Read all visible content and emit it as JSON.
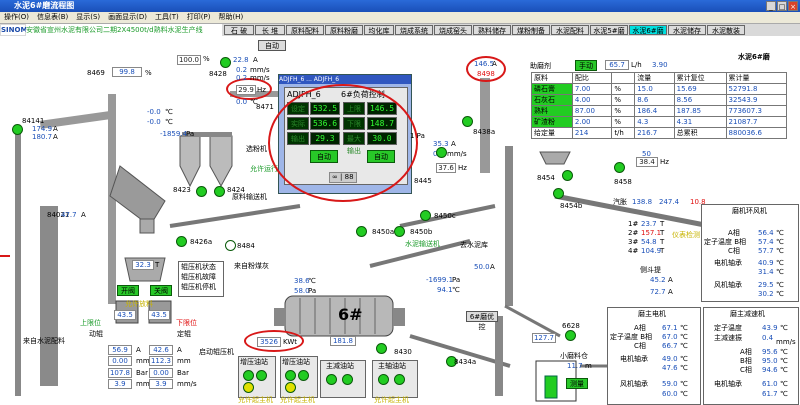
{
  "window": {
    "title": "水泥6#磨流程图",
    "btn_min": "_",
    "btn_max": "□",
    "btn_close": "×"
  },
  "menu": [
    "操作(O)",
    "信息表(B)",
    "显示(S)",
    "画面显示(D)",
    "工具(T)",
    "打印(P)",
    "帮助(H)"
  ],
  "nav": {
    "logo": "SINOMA",
    "title": "安徽省宣州水泥有限公司二期2X4500t/d熟料水泥生产线",
    "tabs": [
      "石 破",
      "长 堆",
      "原料配料",
      "原料粉磨",
      "均化库",
      "烧成系统",
      "烧成窑头",
      "熟料储存",
      "煤粉制备",
      "水泥配料",
      "水泥5#磨",
      "水泥6#磨",
      "水泥储存",
      "水泥散装"
    ]
  },
  "left": {
    "v99": "99.8",
    "pct": "%",
    "id8469": "8469",
    "v100": "100.0",
    "id8428": "8428",
    "hz": "29.9",
    "hz_unit": "Hz",
    "v22": "22.8",
    "v22u": "A",
    "v02a": "0.2",
    "v02au": "mm/s",
    "v02b": "0.2",
    "v02bu": "mm/s",
    "v00": "0.0",
    "v00u": "℃",
    "id84141": "84141",
    "v174": "174.9",
    "v180": "180.7",
    "aA": "A",
    "vm00a": "-0.0",
    "vm00b": "-0.0",
    "deg": "℃",
    "v1859": "-1859.4",
    "pa": "Pa",
    "id84021": "84021",
    "v477": "47.7",
    "auto1": "自动",
    "id8471": "8471",
    "id8423": "8423",
    "id8424": "8424",
    "sel_fan": "选粉机",
    "allow_run1": "允许运行",
    "feed_belt": "原料输送机",
    "id8426a": "8426a",
    "id8484": "8484",
    "from_coal": "来自粉煤灰",
    "v323": "32.3",
    "tt": "T",
    "gate_open": "开阀",
    "gate_close": "关阀",
    "allow_feed": "允许放料",
    "upper_limit": "上限位",
    "lower_limit": "下限位",
    "v435a": "43.5",
    "v435b": "43.5",
    "move": "动辊",
    "fix": "定辊",
    "r569": "56.9",
    "r426": "42.6",
    "r000": "0.00",
    "r112": "112.3",
    "r1078": "107.8",
    "r39a": "3.9",
    "r39b": "3.9",
    "ua": "A",
    "umm": "mm",
    "ubar": "Bar",
    "ums": "mm/s",
    "from_cement": "来自水泥配料",
    "roll_stat": "辊压机状态",
    "roll_fault": "辊压机故障",
    "roll_down": "辊压机停机",
    "start_roll": "启动辊压机",
    "kwh": "3526",
    "kwh_u": "KWt",
    "pump_a": "增压油站",
    "pump_b": "增压油站",
    "allow_run2": "允许起主机",
    "allow_run3": "允许起主机"
  },
  "dialog": {
    "titlebar": "ADJFH_6 ... ADJFH_6",
    "tag": "ADJFH_6",
    "ctrl": "6#负荷控制",
    "r1l": "设定",
    "r1v": "532.5",
    "r1l2": "上限",
    "r1v2": "146.5",
    "r2l": "实际",
    "r2v": "536.6",
    "r2l2": "下限",
    "r2v2": "148.7",
    "r3l": "输出",
    "r3v": "29.3",
    "r3l2": "最大输出",
    "r3v2": "30.0",
    "auto": "自动",
    "auto2": "自动",
    "foot": "∞ | 88"
  },
  "mid": {
    "v353": "35.3",
    "v353u": "A",
    "v02": "0.2",
    "v02u": "mm/s",
    "v376": "37.6",
    "hz": "Hz",
    "id8445": "8445",
    "id8438a": "8438a",
    "pa1": "1 Pa",
    "id8450a": "8450a",
    "id8450b": "8450b",
    "id8450c": "8450c",
    "feed_belt2": "水泥输送机",
    "to_silo": "去水泥库",
    "v500": "50.0",
    "v500u": "A",
    "v1699": "-1699.1",
    "v941": "94.1",
    "pa": "Pa",
    "deg": "℃",
    "v386": "38.6",
    "v580": "58.0",
    "mill": "6#",
    "v1818": "181.8",
    "id8430": "8430",
    "id8434a": "8434a",
    "allow_run4": "允许起主机",
    "lube": "主减油站",
    "main_lube": "主轴油站",
    "id_opt": "6#磨优控"
  },
  "right": {
    "silo_top": "146.5",
    "silo_id": "8498",
    "silo_unit": "A",
    "silo_lbl": "水泥6#磨",
    "feed_title": "助磨剂",
    "feed_auto": "手动",
    "feed_v": "65.7",
    "feed_u": "L/h",
    "feed_v2": "3.90",
    "hdr": [
      "原料",
      "配比",
      "",
      "流量",
      "累计复位",
      "累计量"
    ],
    "rows": [
      {
        "name": "磷石膏",
        "ratio": "7.00",
        "pct": "%",
        "flow": "15.0",
        "fu": "t/h",
        "set": "15.69",
        "su": "t/h",
        "acc": "52791.8",
        "au": "T"
      },
      {
        "name": "石灰石",
        "ratio": "4.00",
        "pct": "%",
        "flow": "8.6",
        "fu": "t/h",
        "set": "8.56",
        "su": "t/h",
        "acc": "32543.9",
        "au": "T"
      },
      {
        "name": "熟料",
        "ratio": "87.00",
        "pct": "%",
        "flow": "186.4",
        "fu": "t/h",
        "set": "187.85",
        "su": "t/h",
        "acc": "773607.3",
        "au": "T"
      },
      {
        "name": "矿渣粉",
        "ratio": "2.00",
        "pct": "%",
        "flow": "4.3",
        "fu": "t/h",
        "set": "4.31",
        "su": "t/h",
        "acc": "21087.7",
        "au": "T"
      }
    ],
    "total_lbl": "给定量",
    "total": "214",
    "total_u": "t/h",
    "total_v": "216.7",
    "total_vu": "t/h",
    "total_acc_lbl": "总累积",
    "total_acc": "880036.6",
    "total_acc_u": "T",
    "v50": "50",
    "v384": "38.4",
    "hz": "Hz",
    "id8454": "8454",
    "id8454b": "8454b",
    "id8458": "8458",
    "zb": "汽胀",
    "v1388": "138.8",
    "v2474": "247.4",
    "v108": "10.8",
    "p1": "1#",
    "p1v": "23.7",
    "p2": "2#",
    "p2v": "157.1",
    "p3": "3#",
    "p3v": "54.8",
    "p4": "4#",
    "p4v": "104.9",
    "tonU": "T",
    "inst": "仪表检测",
    "lift": "侧斗提",
    "lift_a": "45.2",
    "lift_b": "72.7",
    "A": "A",
    "ring_title": "磨机环风机",
    "ring_rows": [
      {
        "l": "A相",
        "v": "56.4",
        "u": "℃"
      },
      {
        "l": "定子温度 B相",
        "v": "57.4",
        "u": "℃"
      },
      {
        "l": "C相",
        "v": "57.7",
        "u": "℃"
      },
      {
        "l": "电机轴承",
        "v": "40.9",
        "u": "℃"
      },
      {
        "l": "",
        "v": "31.4",
        "u": "℃"
      },
      {
        "l": "风机轴承",
        "v": "29.5",
        "u": "℃"
      },
      {
        "l": "",
        "v": "30.2",
        "u": "℃"
      }
    ],
    "mainm_title": "磨主电机",
    "mainm_rows": [
      {
        "l": "A相",
        "v": "67.1",
        "u": "℃"
      },
      {
        "l": "定子温度 B相",
        "v": "67.0",
        "u": "℃"
      },
      {
        "l": "C相",
        "v": "66.7",
        "u": "℃"
      },
      {
        "l": "电机轴承",
        "v": "49.0",
        "u": "℃"
      },
      {
        "l": "",
        "v": "47.6",
        "u": "℃"
      },
      {
        "l": "风机轴承",
        "v": "59.0",
        "u": "℃"
      },
      {
        "l": "",
        "v": "60.0",
        "u": "℃"
      }
    ],
    "mainr_title": "磨主减速机",
    "mainr_rows": [
      {
        "l": "定子温度",
        "v": "43.9",
        "u": "℃"
      },
      {
        "l": "主减速振",
        "v": "0.4",
        "u": "mm/s"
      },
      {
        "l": "A相",
        "v": "95.6",
        "u": "℃"
      },
      {
        "l": "B相",
        "v": "95.0",
        "u": "℃"
      },
      {
        "l": "C相",
        "v": "94.6",
        "u": "℃"
      },
      {
        "l": "电机轴承",
        "v": "61.0",
        "u": "℃"
      },
      {
        "l": "",
        "v": "61.7",
        "u": "℃"
      }
    ],
    "id6628": "6628",
    "v1277": "127.7",
    "small_mill": "小磨料仓",
    "small_v": "11.7",
    "small_u": "m",
    "meas": "测量"
  },
  "colors": {
    "accent": "#00e0e0",
    "green": "#22cc22",
    "alarm": "#e01010",
    "link": "#1a4fb8"
  }
}
